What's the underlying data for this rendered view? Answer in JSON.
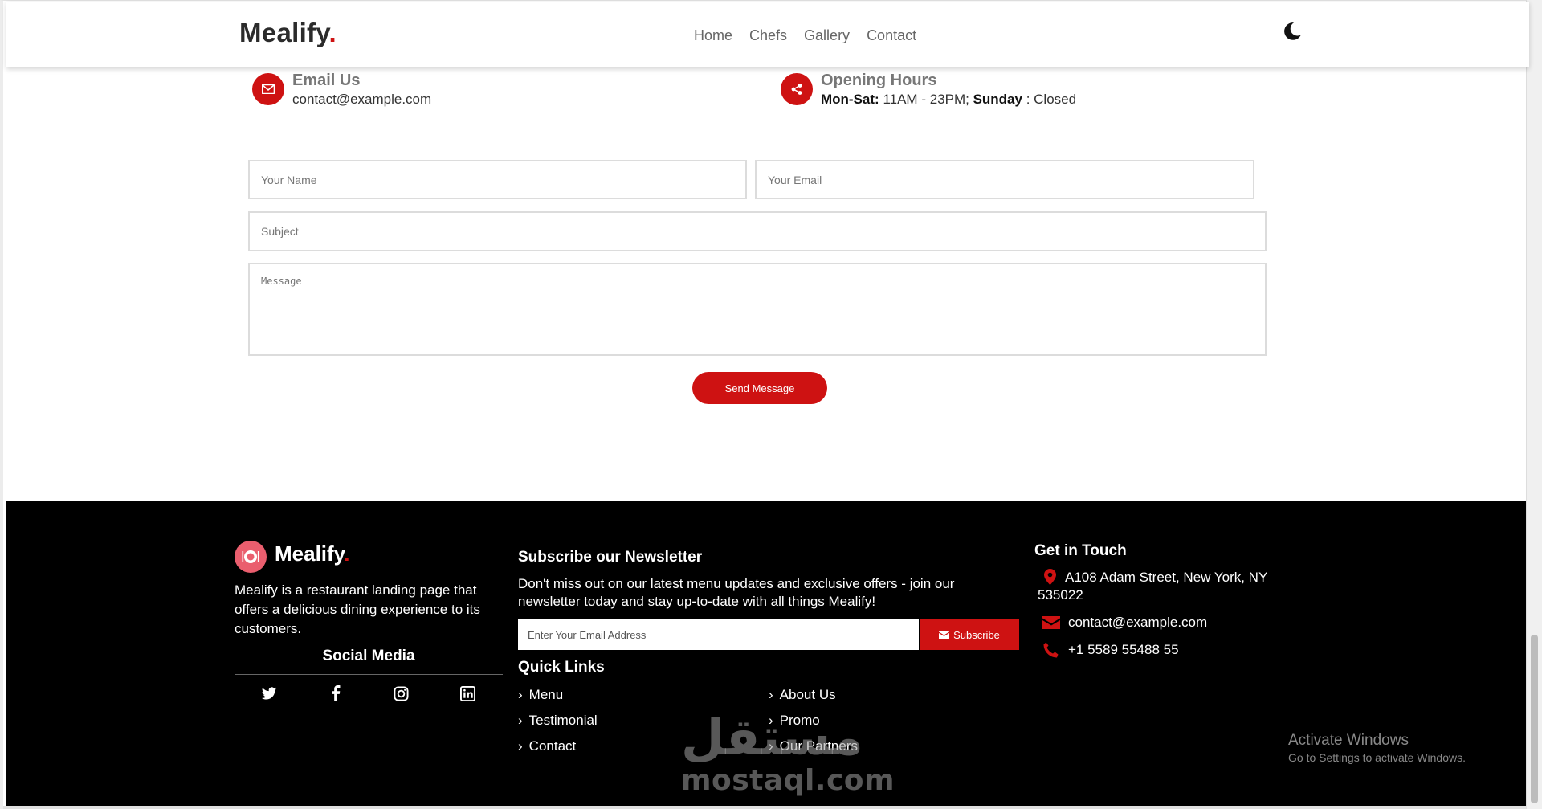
{
  "header": {
    "logo": "Mealify",
    "logo_dot": ".",
    "nav": [
      "Home",
      "Chefs",
      "Gallery",
      "Contact"
    ]
  },
  "contact_info": {
    "email": {
      "title": "Email Us",
      "value": "contact@example.com"
    },
    "hours": {
      "title": "Opening Hours",
      "days_label": "Mon-Sat:",
      "days_value": " 11AM - 23PM; ",
      "sunday_label": "Sunday",
      "sunday_value": " : Closed"
    }
  },
  "form": {
    "name_placeholder": "Your Name",
    "email_placeholder": "Your Email",
    "subject_placeholder": "Subject",
    "message_placeholder": "Message",
    "submit_label": "Send Message"
  },
  "footer": {
    "brand": "Mealify",
    "brand_dot": ".",
    "description": "Mealify is a restaurant landing page that offers a delicious dining experience to its customers.",
    "social_title": "Social Media",
    "social_icons": [
      "twitter-icon",
      "facebook-icon",
      "instagram-icon",
      "linkedin-icon"
    ],
    "newsletter": {
      "title": "Subscribe our Newsletter",
      "text": "Don't miss out on our latest menu updates and exclusive offers - join our newsletter today and stay up-to-date with all things Mealify!",
      "input_placeholder": "Enter Your Email Address",
      "button_label": "Subscribe"
    },
    "quick_links": {
      "title": "Quick Links",
      "col1": [
        "Menu",
        "Testimonial",
        "Contact"
      ],
      "col2": [
        "About Us",
        "Promo",
        "Our Partners"
      ]
    },
    "touch": {
      "title": "Get in Touch",
      "address": "A108 Adam Street, New York, NY 535022",
      "email": "contact@example.com",
      "phone": "+1 5589 55488 55"
    }
  },
  "watermark": {
    "arabic": "مستقل",
    "latin": "mostaql.com"
  },
  "activate_windows": {
    "line1": "Activate Windows",
    "line2": "Go to Settings to activate Windows."
  },
  "colors": {
    "accent": "#ce1212",
    "footer_bg": "#000000",
    "logo_icon_bg": "#ea5e6e"
  }
}
